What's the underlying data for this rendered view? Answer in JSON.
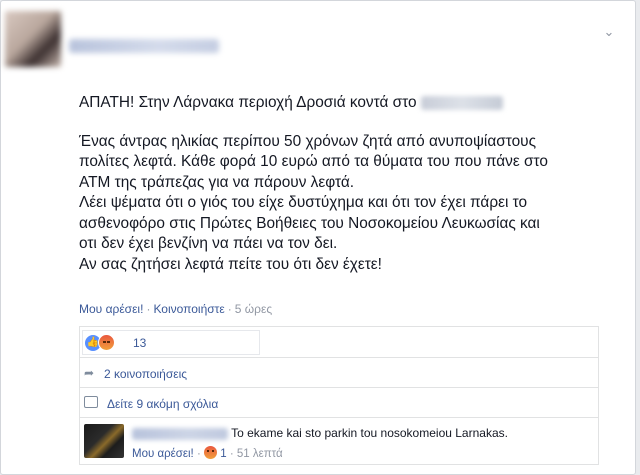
{
  "post": {
    "text_lines": [
      "ΑΠΑΤΗ! Στην Λάρνακα περιοχή Δροσιά κοντά στο",
      "Ένας άντρας ηλικίας περίπου 50 χρόνων ζητά από ανυποψίαστους",
      "πολίτες λεφτά. Κάθε φορά 10 ευρώ από τα θύματα του που πάνε στο",
      "ΑΤΜ της τράπεζας για να πάρουν λεφτά.",
      "Λέει ψέματα ότι ο γιός του είχε δυστύχημα και ότι τον έχει πάρει το",
      "ασθενοφόρο στις Πρώτες Βοήθειες του Νοσοκομείου Λευκωσίας και",
      "οτι δεν έχει βενζίνη να πάει να τον δει.",
      "Αν σας ζητήσει λεφτά πείτε του ότι δεν έχετε!"
    ]
  },
  "actions": {
    "like_label": "Μου αρέσει!",
    "share_label": "Κοινοποιήστε",
    "time": "5 ώρες",
    "separator": "·"
  },
  "reactions": {
    "count": "13",
    "icons": [
      "like-reaction-icon",
      "angry-reaction-icon"
    ]
  },
  "shares": {
    "label": "2 κοινοποιήσεις"
  },
  "comments": {
    "view_more_label": "Δείτε 9 ακόμη σχόλια"
  },
  "comment": {
    "text": "To ekame kai sto parkin tou nosokomeiou Larnakas.",
    "like_label": "Μου αρέσει!",
    "reaction_count": "1",
    "time": "51 λεπτά",
    "separator": "·"
  },
  "icons": {
    "chevron": "chevron-down-icon",
    "share": "share-arrow-icon",
    "comment": "comment-bubble-icon"
  },
  "colors": {
    "link": "#3b5998",
    "meta": "#9197a3",
    "text": "#141823",
    "like_blue": "#5890ff",
    "angry_orange": "#e9573e"
  }
}
